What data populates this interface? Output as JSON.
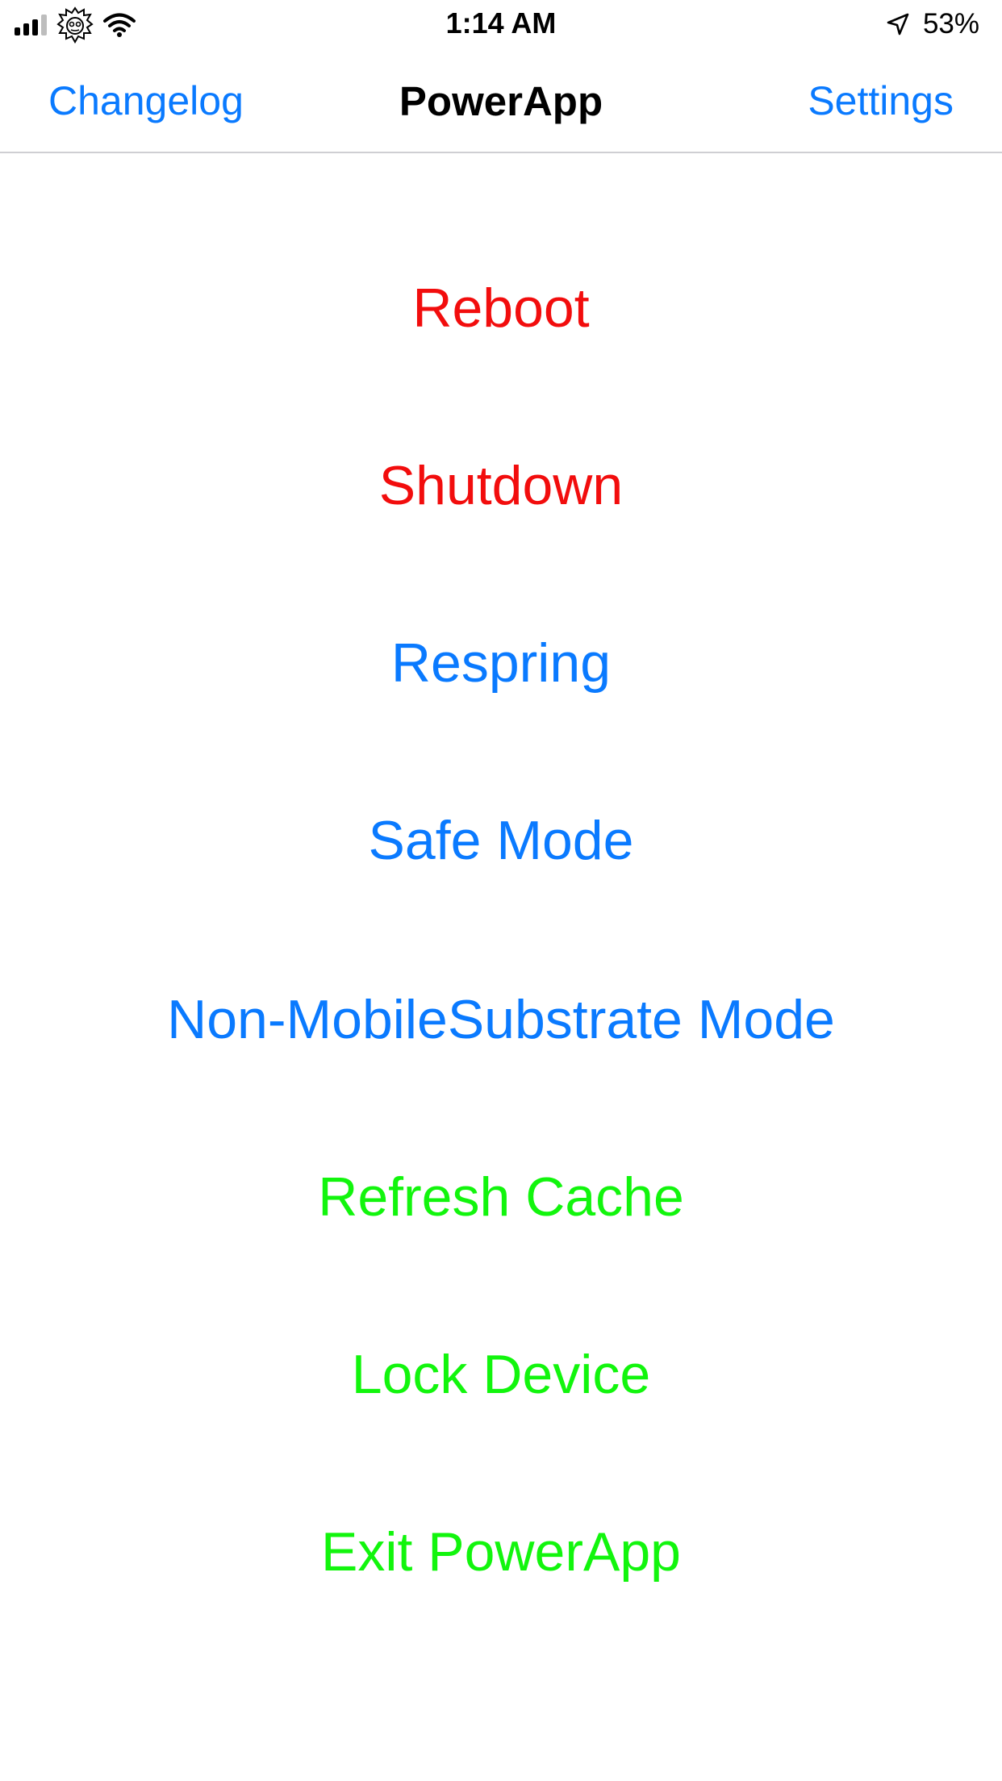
{
  "status_bar": {
    "time": "1:14 AM",
    "battery": "53%"
  },
  "nav": {
    "left_label": "Changelog",
    "title": "PowerApp",
    "right_label": "Settings"
  },
  "actions": [
    {
      "label": "Reboot",
      "color": "#f20d0d"
    },
    {
      "label": "Shutdown",
      "color": "#f20d0d"
    },
    {
      "label": "Respring",
      "color": "#0a7aff"
    },
    {
      "label": "Safe Mode",
      "color": "#0a7aff"
    },
    {
      "label": "Non-MobileSubstrate Mode",
      "color": "#0a7aff"
    },
    {
      "label": "Refresh Cache",
      "color": "#12f50d"
    },
    {
      "label": "Lock Device",
      "color": "#12f50d"
    },
    {
      "label": "Exit PowerApp",
      "color": "#12f50d"
    }
  ],
  "colors": {
    "accent": "#0a7aff",
    "danger": "#f20d0d",
    "success": "#12f50d"
  }
}
